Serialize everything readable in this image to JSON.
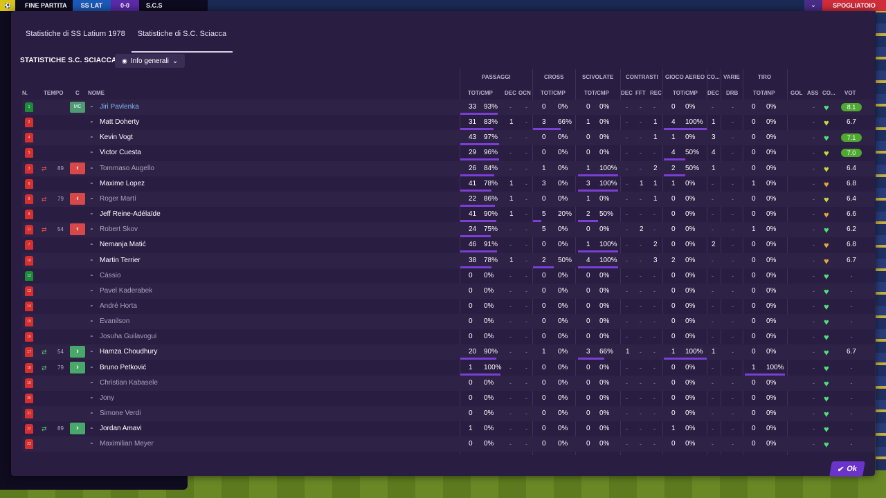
{
  "topbar": {
    "badge_icon": "ball-icon",
    "status": "FINE PARTITA",
    "home_team": "SS LAT",
    "score": "0-0",
    "away_team": "S.C.S"
  },
  "top_right": {
    "chevron": "⌄",
    "locker": "SPOGLIATOIO"
  },
  "tabs": [
    {
      "label": "Statistiche di SS Latium 1978",
      "active": false
    },
    {
      "label": "Statistiche di S.C. Sciacca",
      "active": true
    }
  ],
  "section_title": "STATISTICHE S.C. SCIACCA",
  "view_select": {
    "label": "Info generali"
  },
  "group_headers": [
    "PASSAGGI",
    "CROSS",
    "SCIVOLATE",
    "CONTRASTI",
    "GIOCO AEREO",
    "CO...",
    "VARIE",
    "TIRO"
  ],
  "columns": {
    "n": "N.",
    "tempo": "TEMPO",
    "c": "C",
    "nome": "NOME",
    "pass": "TOT/CMP",
    "pass_dec": "DEC",
    "pass_ocn": "OCN",
    "cross": "TOT/CMP",
    "sciv": "TOT/CMP",
    "con_dec": "DEC",
    "con_fft": "FFT",
    "con_rec": "REC",
    "aer": "TOT/CMP",
    "co_dec": "DEC",
    "drb": "DRB",
    "tiro": "TOT/INP",
    "gol": "GOL",
    "ass": "ASS",
    "con": "CO...",
    "vot": "VOT"
  },
  "players": [
    {
      "no": "1",
      "gk": true,
      "sub": "",
      "min": "",
      "box": "",
      "pos": "MC",
      "name": "Jiri Pavlenka",
      "style": "link",
      "p": [
        "33",
        "93%"
      ],
      "pb": 0.93,
      "pd": "-",
      "po": "-",
      "c": [
        "0",
        "0%"
      ],
      "cb": 0,
      "s": [
        "0",
        "0%"
      ],
      "sb": 0,
      "cd": "-",
      "cf": "-",
      "cr": "-",
      "a": [
        "0",
        "0%"
      ],
      "ab": 0,
      "ad": "-",
      "dr": "-",
      "t": [
        "0",
        "0%"
      ],
      "tb": 0,
      "g": "",
      "as": "-",
      "hc": "#4ee07a",
      "v": "8.1",
      "vh": true
    },
    {
      "no": "2",
      "gk": false,
      "sub": "",
      "min": "",
      "box": "",
      "pos": "",
      "name": "Matt Doherty",
      "style": "",
      "p": [
        "31",
        "83%"
      ],
      "pb": 0.83,
      "pd": "1",
      "po": "-",
      "c": [
        "3",
        "66%"
      ],
      "cb": 0.66,
      "s": [
        "1",
        "0%"
      ],
      "sb": 0,
      "cd": "-",
      "cf": "-",
      "cr": "1",
      "a": [
        "4",
        "100%"
      ],
      "ab": 1,
      "ad": "1",
      "dr": "-",
      "t": [
        "0",
        "0%"
      ],
      "tb": 0,
      "g": "",
      "as": "-",
      "hc": "#c8d83a",
      "v": "6.7",
      "vh": false
    },
    {
      "no": "4",
      "gk": false,
      "sub": "",
      "min": "",
      "box": "",
      "pos": "",
      "name": "Kevin Vogt",
      "style": "",
      "p": [
        "43",
        "97%"
      ],
      "pb": 0.97,
      "pd": "-",
      "po": "-",
      "c": [
        "0",
        "0%"
      ],
      "cb": 0,
      "s": [
        "0",
        "0%"
      ],
      "sb": 0,
      "cd": "-",
      "cf": "-",
      "cr": "1",
      "a": [
        "1",
        "0%"
      ],
      "ab": 0,
      "ad": "3",
      "dr": "-",
      "t": [
        "0",
        "0%"
      ],
      "tb": 0,
      "g": "",
      "as": "-",
      "hc": "#4ee07a",
      "v": "7.1",
      "vh": true
    },
    {
      "no": "5",
      "gk": false,
      "sub": "",
      "min": "",
      "box": "",
      "pos": "",
      "name": "Victor Cuesta",
      "style": "",
      "p": [
        "29",
        "96%"
      ],
      "pb": 0.96,
      "pd": "-",
      "po": "-",
      "c": [
        "0",
        "0%"
      ],
      "cb": 0,
      "s": [
        "0",
        "0%"
      ],
      "sb": 0,
      "cd": "-",
      "cf": "-",
      "cr": "-",
      "a": [
        "4",
        "50%"
      ],
      "ab": 0.5,
      "ad": "4",
      "dr": "-",
      "t": [
        "0",
        "0%"
      ],
      "tb": 0,
      "g": "",
      "as": "-",
      "hc": "#c8d83a",
      "v": "7.0",
      "vh": true
    },
    {
      "no": "3",
      "gk": false,
      "sub": "out",
      "min": "89",
      "box": "out",
      "pos": "",
      "name": "Tommaso Augello",
      "style": "faded",
      "p": [
        "26",
        "84%"
      ],
      "pb": 0.84,
      "pd": "-",
      "po": "-",
      "c": [
        "1",
        "0%"
      ],
      "cb": 0,
      "s": [
        "1",
        "100%"
      ],
      "sb": 1,
      "cd": "-",
      "cf": "-",
      "cr": "2",
      "a": [
        "2",
        "50%"
      ],
      "ab": 0.5,
      "ad": "1",
      "dr": "-",
      "t": [
        "0",
        "0%"
      ],
      "tb": 0,
      "g": "",
      "as": "-",
      "hc": "#c8d83a",
      "v": "6.4",
      "vh": false
    },
    {
      "no": "6",
      "gk": false,
      "sub": "",
      "min": "",
      "box": "",
      "pos": "",
      "name": "Maxime Lopez",
      "style": "",
      "p": [
        "41",
        "78%"
      ],
      "pb": 0.78,
      "pd": "1",
      "po": "-",
      "c": [
        "3",
        "0%"
      ],
      "cb": 0,
      "s": [
        "3",
        "100%"
      ],
      "sb": 1,
      "cd": "-",
      "cf": "1",
      "cr": "1",
      "a": [
        "1",
        "0%"
      ],
      "ab": 0,
      "ad": "-",
      "dr": "-",
      "t": [
        "1",
        "0%"
      ],
      "tb": 0,
      "g": "",
      "as": "-",
      "hc": "#e0a83a",
      "v": "6.8",
      "vh": false
    },
    {
      "no": "9",
      "gk": false,
      "sub": "out",
      "min": "79",
      "box": "out",
      "pos": "",
      "name": "Roger Martí",
      "style": "faded",
      "p": [
        "22",
        "86%"
      ],
      "pb": 0.86,
      "pd": "1",
      "po": "-",
      "c": [
        "0",
        "0%"
      ],
      "cb": 0,
      "s": [
        "1",
        "0%"
      ],
      "sb": 0,
      "cd": "-",
      "cf": "-",
      "cr": "1",
      "a": [
        "0",
        "0%"
      ],
      "ab": 0,
      "ad": "-",
      "dr": "-",
      "t": [
        "0",
        "0%"
      ],
      "tb": 0,
      "g": "",
      "as": "-",
      "hc": "#c8d83a",
      "v": "6.4",
      "vh": false
    },
    {
      "no": "8",
      "gk": false,
      "sub": "",
      "min": "",
      "box": "",
      "pos": "",
      "name": "Jeff Reine-Adélaïde",
      "style": "",
      "p": [
        "41",
        "90%"
      ],
      "pb": 0.9,
      "pd": "1",
      "po": "-",
      "c": [
        "5",
        "20%"
      ],
      "cb": 0.2,
      "s": [
        "2",
        "50%"
      ],
      "sb": 0.5,
      "cd": "-",
      "cf": "-",
      "cr": "-",
      "a": [
        "0",
        "0%"
      ],
      "ab": 0,
      "ad": "-",
      "dr": "-",
      "t": [
        "0",
        "0%"
      ],
      "tb": 0,
      "g": "",
      "as": "-",
      "hc": "#e0a83a",
      "v": "6.6",
      "vh": false
    },
    {
      "no": "11",
      "gk": false,
      "sub": "out",
      "min": "54",
      "box": "out",
      "pos": "",
      "name": "Robert Skov",
      "style": "faded",
      "p": [
        "24",
        "75%"
      ],
      "pb": 0.75,
      "pd": "-",
      "po": "-",
      "c": [
        "5",
        "0%"
      ],
      "cb": 0,
      "s": [
        "0",
        "0%"
      ],
      "sb": 0,
      "cd": "-",
      "cf": "2",
      "cr": "-",
      "a": [
        "0",
        "0%"
      ],
      "ab": 0,
      "ad": "-",
      "dr": "-",
      "t": [
        "1",
        "0%"
      ],
      "tb": 0,
      "g": "",
      "as": "-",
      "hc": "#4ee07a",
      "v": "6.2",
      "vh": false
    },
    {
      "no": "7",
      "gk": false,
      "sub": "",
      "min": "",
      "box": "",
      "pos": "",
      "name": "Nemanja Matić",
      "style": "",
      "p": [
        "46",
        "91%"
      ],
      "pb": 0.91,
      "pd": "-",
      "po": "-",
      "c": [
        "0",
        "0%"
      ],
      "cb": 0,
      "s": [
        "1",
        "100%"
      ],
      "sb": 1,
      "cd": "-",
      "cf": "-",
      "cr": "2",
      "a": [
        "0",
        "0%"
      ],
      "ab": 0,
      "ad": "2",
      "dr": "-",
      "t": [
        "0",
        "0%"
      ],
      "tb": 0,
      "g": "",
      "as": "-",
      "hc": "#e0a83a",
      "v": "6.8",
      "vh": false
    },
    {
      "no": "10",
      "gk": false,
      "sub": "",
      "min": "",
      "box": "",
      "pos": "",
      "name": "Martin Terrier",
      "style": "",
      "p": [
        "38",
        "78%"
      ],
      "pb": 0.78,
      "pd": "1",
      "po": "-",
      "c": [
        "2",
        "50%"
      ],
      "cb": 0.5,
      "s": [
        "4",
        "100%"
      ],
      "sb": 1,
      "cd": "-",
      "cf": "-",
      "cr": "3",
      "a": [
        "2",
        "0%"
      ],
      "ab": 0,
      "ad": "-",
      "dr": "-",
      "t": [
        "0",
        "0%"
      ],
      "tb": 0,
      "g": "",
      "as": "-",
      "hc": "#e0a83a",
      "v": "6.7",
      "vh": false
    },
    {
      "no": "12",
      "gk": true,
      "sub": "",
      "min": "",
      "box": "",
      "pos": "",
      "name": "Cássio",
      "style": "faded",
      "p": [
        "0",
        "0%"
      ],
      "pb": 0,
      "pd": "-",
      "po": "-",
      "c": [
        "0",
        "0%"
      ],
      "cb": 0,
      "s": [
        "0",
        "0%"
      ],
      "sb": 0,
      "cd": "-",
      "cf": "-",
      "cr": "-",
      "a": [
        "0",
        "0%"
      ],
      "ab": 0,
      "ad": "-",
      "dr": "-",
      "t": [
        "0",
        "0%"
      ],
      "tb": 0,
      "g": "",
      "as": "-",
      "hc": "#4ee07a",
      "v": "-",
      "vh": false
    },
    {
      "no": "13",
      "gk": false,
      "sub": "",
      "min": "",
      "box": "",
      "pos": "",
      "name": "Pavel Kaderabek",
      "style": "faded",
      "p": [
        "0",
        "0%"
      ],
      "pb": 0,
      "pd": "-",
      "po": "-",
      "c": [
        "0",
        "0%"
      ],
      "cb": 0,
      "s": [
        "0",
        "0%"
      ],
      "sb": 0,
      "cd": "-",
      "cf": "-",
      "cr": "-",
      "a": [
        "0",
        "0%"
      ],
      "ab": 0,
      "ad": "-",
      "dr": "-",
      "t": [
        "0",
        "0%"
      ],
      "tb": 0,
      "g": "",
      "as": "-",
      "hc": "#4ee07a",
      "v": "-",
      "vh": false
    },
    {
      "no": "14",
      "gk": false,
      "sub": "",
      "min": "",
      "box": "",
      "pos": "",
      "name": "André Horta",
      "style": "faded",
      "p": [
        "0",
        "0%"
      ],
      "pb": 0,
      "pd": "-",
      "po": "-",
      "c": [
        "0",
        "0%"
      ],
      "cb": 0,
      "s": [
        "0",
        "0%"
      ],
      "sb": 0,
      "cd": "-",
      "cf": "-",
      "cr": "-",
      "a": [
        "0",
        "0%"
      ],
      "ab": 0,
      "ad": "-",
      "dr": "-",
      "t": [
        "0",
        "0%"
      ],
      "tb": 0,
      "g": "",
      "as": "-",
      "hc": "#4ee07a",
      "v": "-",
      "vh": false
    },
    {
      "no": "15",
      "gk": false,
      "sub": "",
      "min": "",
      "box": "",
      "pos": "",
      "name": "Evanilson",
      "style": "faded",
      "p": [
        "0",
        "0%"
      ],
      "pb": 0,
      "pd": "-",
      "po": "-",
      "c": [
        "0",
        "0%"
      ],
      "cb": 0,
      "s": [
        "0",
        "0%"
      ],
      "sb": 0,
      "cd": "-",
      "cf": "-",
      "cr": "-",
      "a": [
        "0",
        "0%"
      ],
      "ab": 0,
      "ad": "-",
      "dr": "-",
      "t": [
        "0",
        "0%"
      ],
      "tb": 0,
      "g": "",
      "as": "-",
      "hc": "#4ee07a",
      "v": "-",
      "vh": false
    },
    {
      "no": "16",
      "gk": false,
      "sub": "",
      "min": "",
      "box": "",
      "pos": "",
      "name": "Josuha Guilavogui",
      "style": "faded",
      "p": [
        "0",
        "0%"
      ],
      "pb": 0,
      "pd": "-",
      "po": "-",
      "c": [
        "0",
        "0%"
      ],
      "cb": 0,
      "s": [
        "0",
        "0%"
      ],
      "sb": 0,
      "cd": "-",
      "cf": "-",
      "cr": "-",
      "a": [
        "0",
        "0%"
      ],
      "ab": 0,
      "ad": "-",
      "dr": "-",
      "t": [
        "0",
        "0%"
      ],
      "tb": 0,
      "g": "",
      "as": "-",
      "hc": "#4ee07a",
      "v": "-",
      "vh": false
    },
    {
      "no": "17",
      "gk": false,
      "sub": "in",
      "min": "54",
      "box": "in",
      "pos": "",
      "name": "Hamza Choudhury",
      "style": "",
      "p": [
        "20",
        "90%"
      ],
      "pb": 0.9,
      "pd": "-",
      "po": "-",
      "c": [
        "1",
        "0%"
      ],
      "cb": 0,
      "s": [
        "3",
        "66%"
      ],
      "sb": 0.66,
      "cd": "1",
      "cf": "-",
      "cr": "-",
      "a": [
        "1",
        "100%"
      ],
      "ab": 1,
      "ad": "1",
      "dr": "-",
      "t": [
        "0",
        "0%"
      ],
      "tb": 0,
      "g": "",
      "as": "-",
      "hc": "#4ee07a",
      "v": "6.7",
      "vh": false
    },
    {
      "no": "18",
      "gk": false,
      "sub": "in",
      "min": "79",
      "box": "in",
      "pos": "",
      "name": "Bruno Petković",
      "style": "",
      "p": [
        "1",
        "100%"
      ],
      "pb": 1,
      "pd": "-",
      "po": "-",
      "c": [
        "0",
        "0%"
      ],
      "cb": 0,
      "s": [
        "0",
        "0%"
      ],
      "sb": 0,
      "cd": "-",
      "cf": "-",
      "cr": "-",
      "a": [
        "0",
        "0%"
      ],
      "ab": 0,
      "ad": "-",
      "dr": "-",
      "t": [
        "1",
        "100%"
      ],
      "tb": 1,
      "g": "",
      "as": "-",
      "hc": "#4ee07a",
      "v": "-",
      "vh": false
    },
    {
      "no": "19",
      "gk": false,
      "sub": "",
      "min": "",
      "box": "",
      "pos": "",
      "name": "Christian Kabasele",
      "style": "faded",
      "p": [
        "0",
        "0%"
      ],
      "pb": 0,
      "pd": "-",
      "po": "-",
      "c": [
        "0",
        "0%"
      ],
      "cb": 0,
      "s": [
        "0",
        "0%"
      ],
      "sb": 0,
      "cd": "-",
      "cf": "-",
      "cr": "-",
      "a": [
        "0",
        "0%"
      ],
      "ab": 0,
      "ad": "-",
      "dr": "-",
      "t": [
        "0",
        "0%"
      ],
      "tb": 0,
      "g": "",
      "as": "-",
      "hc": "#4ee07a",
      "v": "-",
      "vh": false
    },
    {
      "no": "20",
      "gk": false,
      "sub": "",
      "min": "",
      "box": "",
      "pos": "",
      "name": "Jony",
      "style": "faded",
      "p": [
        "0",
        "0%"
      ],
      "pb": 0,
      "pd": "-",
      "po": "-",
      "c": [
        "0",
        "0%"
      ],
      "cb": 0,
      "s": [
        "0",
        "0%"
      ],
      "sb": 0,
      "cd": "-",
      "cf": "-",
      "cr": "-",
      "a": [
        "0",
        "0%"
      ],
      "ab": 0,
      "ad": "-",
      "dr": "-",
      "t": [
        "0",
        "0%"
      ],
      "tb": 0,
      "g": "",
      "as": "-",
      "hc": "#4ee07a",
      "v": "-",
      "vh": false
    },
    {
      "no": "21",
      "gk": false,
      "sub": "",
      "min": "",
      "box": "",
      "pos": "",
      "name": "Simone Verdi",
      "style": "faded",
      "p": [
        "0",
        "0%"
      ],
      "pb": 0,
      "pd": "-",
      "po": "-",
      "c": [
        "0",
        "0%"
      ],
      "cb": 0,
      "s": [
        "0",
        "0%"
      ],
      "sb": 0,
      "cd": "-",
      "cf": "-",
      "cr": "-",
      "a": [
        "0",
        "0%"
      ],
      "ab": 0,
      "ad": "-",
      "dr": "-",
      "t": [
        "0",
        "0%"
      ],
      "tb": 0,
      "g": "",
      "as": "-",
      "hc": "#4ee07a",
      "v": "-",
      "vh": false
    },
    {
      "no": "22",
      "gk": false,
      "sub": "in",
      "min": "89",
      "box": "in",
      "pos": "",
      "name": "Jordan Amavi",
      "style": "",
      "p": [
        "1",
        "0%"
      ],
      "pb": 0,
      "pd": "-",
      "po": "-",
      "c": [
        "0",
        "0%"
      ],
      "cb": 0,
      "s": [
        "0",
        "0%"
      ],
      "sb": 0,
      "cd": "-",
      "cf": "-",
      "cr": "-",
      "a": [
        "1",
        "0%"
      ],
      "ab": 0,
      "ad": "-",
      "dr": "-",
      "t": [
        "0",
        "0%"
      ],
      "tb": 0,
      "g": "",
      "as": "-",
      "hc": "#4ee07a",
      "v": "-",
      "vh": false
    },
    {
      "no": "23",
      "gk": false,
      "sub": "",
      "min": "",
      "box": "",
      "pos": "",
      "name": "Maximilian Meyer",
      "style": "faded",
      "p": [
        "0",
        "0%"
      ],
      "pb": 0,
      "pd": "-",
      "po": "-",
      "c": [
        "0",
        "0%"
      ],
      "cb": 0,
      "s": [
        "0",
        "0%"
      ],
      "sb": 0,
      "cd": "-",
      "cf": "-",
      "cr": "-",
      "a": [
        "0",
        "0%"
      ],
      "ab": 0,
      "ad": "-",
      "dr": "-",
      "t": [
        "0",
        "0%"
      ],
      "tb": 0,
      "g": "",
      "as": "-",
      "hc": "#4ee07a",
      "v": "-",
      "vh": false
    }
  ],
  "ok_button": {
    "label": "Ok",
    "icon": "check-icon"
  }
}
